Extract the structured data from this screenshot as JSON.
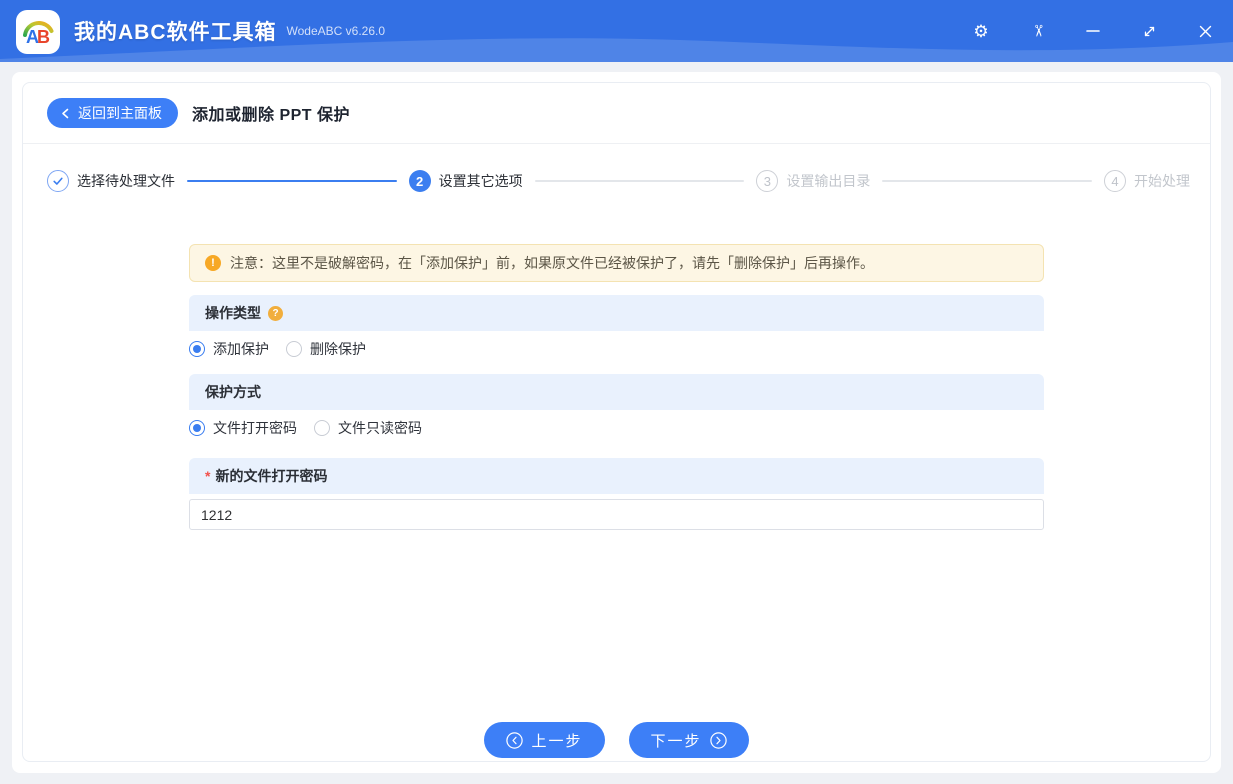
{
  "window": {
    "logo_text": "AB",
    "app_title": "我的ABC软件工具箱",
    "version": "WodeABC v6.26.0",
    "icons": {
      "settings": "⚙",
      "scissors": "✂"
    }
  },
  "header": {
    "back_label": "返回到主面板",
    "page_title": "添加或删除 PPT 保护"
  },
  "steps": [
    {
      "num": "✓",
      "label": "选择待处理文件",
      "state": "done"
    },
    {
      "num": "2",
      "label": "设置其它选项",
      "state": "active"
    },
    {
      "num": "3",
      "label": "设置输出目录",
      "state": "pending"
    },
    {
      "num": "4",
      "label": "开始处理",
      "state": "pending"
    }
  ],
  "notice": {
    "icon": "!",
    "text": "注意：这里不是破解密码，在「添加保护」前，如果原文件已经被保护了，请先「删除保护」后再操作。"
  },
  "form": {
    "operation_type": {
      "label": "操作类型",
      "help_icon": "?",
      "options": [
        {
          "label": "添加保护",
          "selected": true
        },
        {
          "label": "删除保护",
          "selected": false
        }
      ]
    },
    "protection_mode": {
      "label": "保护方式",
      "options": [
        {
          "label": "文件打开密码",
          "selected": true
        },
        {
          "label": "文件只读密码",
          "selected": false
        }
      ]
    },
    "password_field": {
      "required_mark": "*",
      "label": "新的文件打开密码",
      "value": "1212"
    }
  },
  "footer": {
    "prev_label": "上一步",
    "next_label": "下一步"
  },
  "colors": {
    "titlebar": "#3370e4",
    "accent": "#3a7df0",
    "section_band": "#e9f1fd",
    "notice_bg": "#fdf6e4",
    "notice_border": "#f4e3b2",
    "notice_icon": "#f7a825",
    "required": "#f2504b"
  }
}
